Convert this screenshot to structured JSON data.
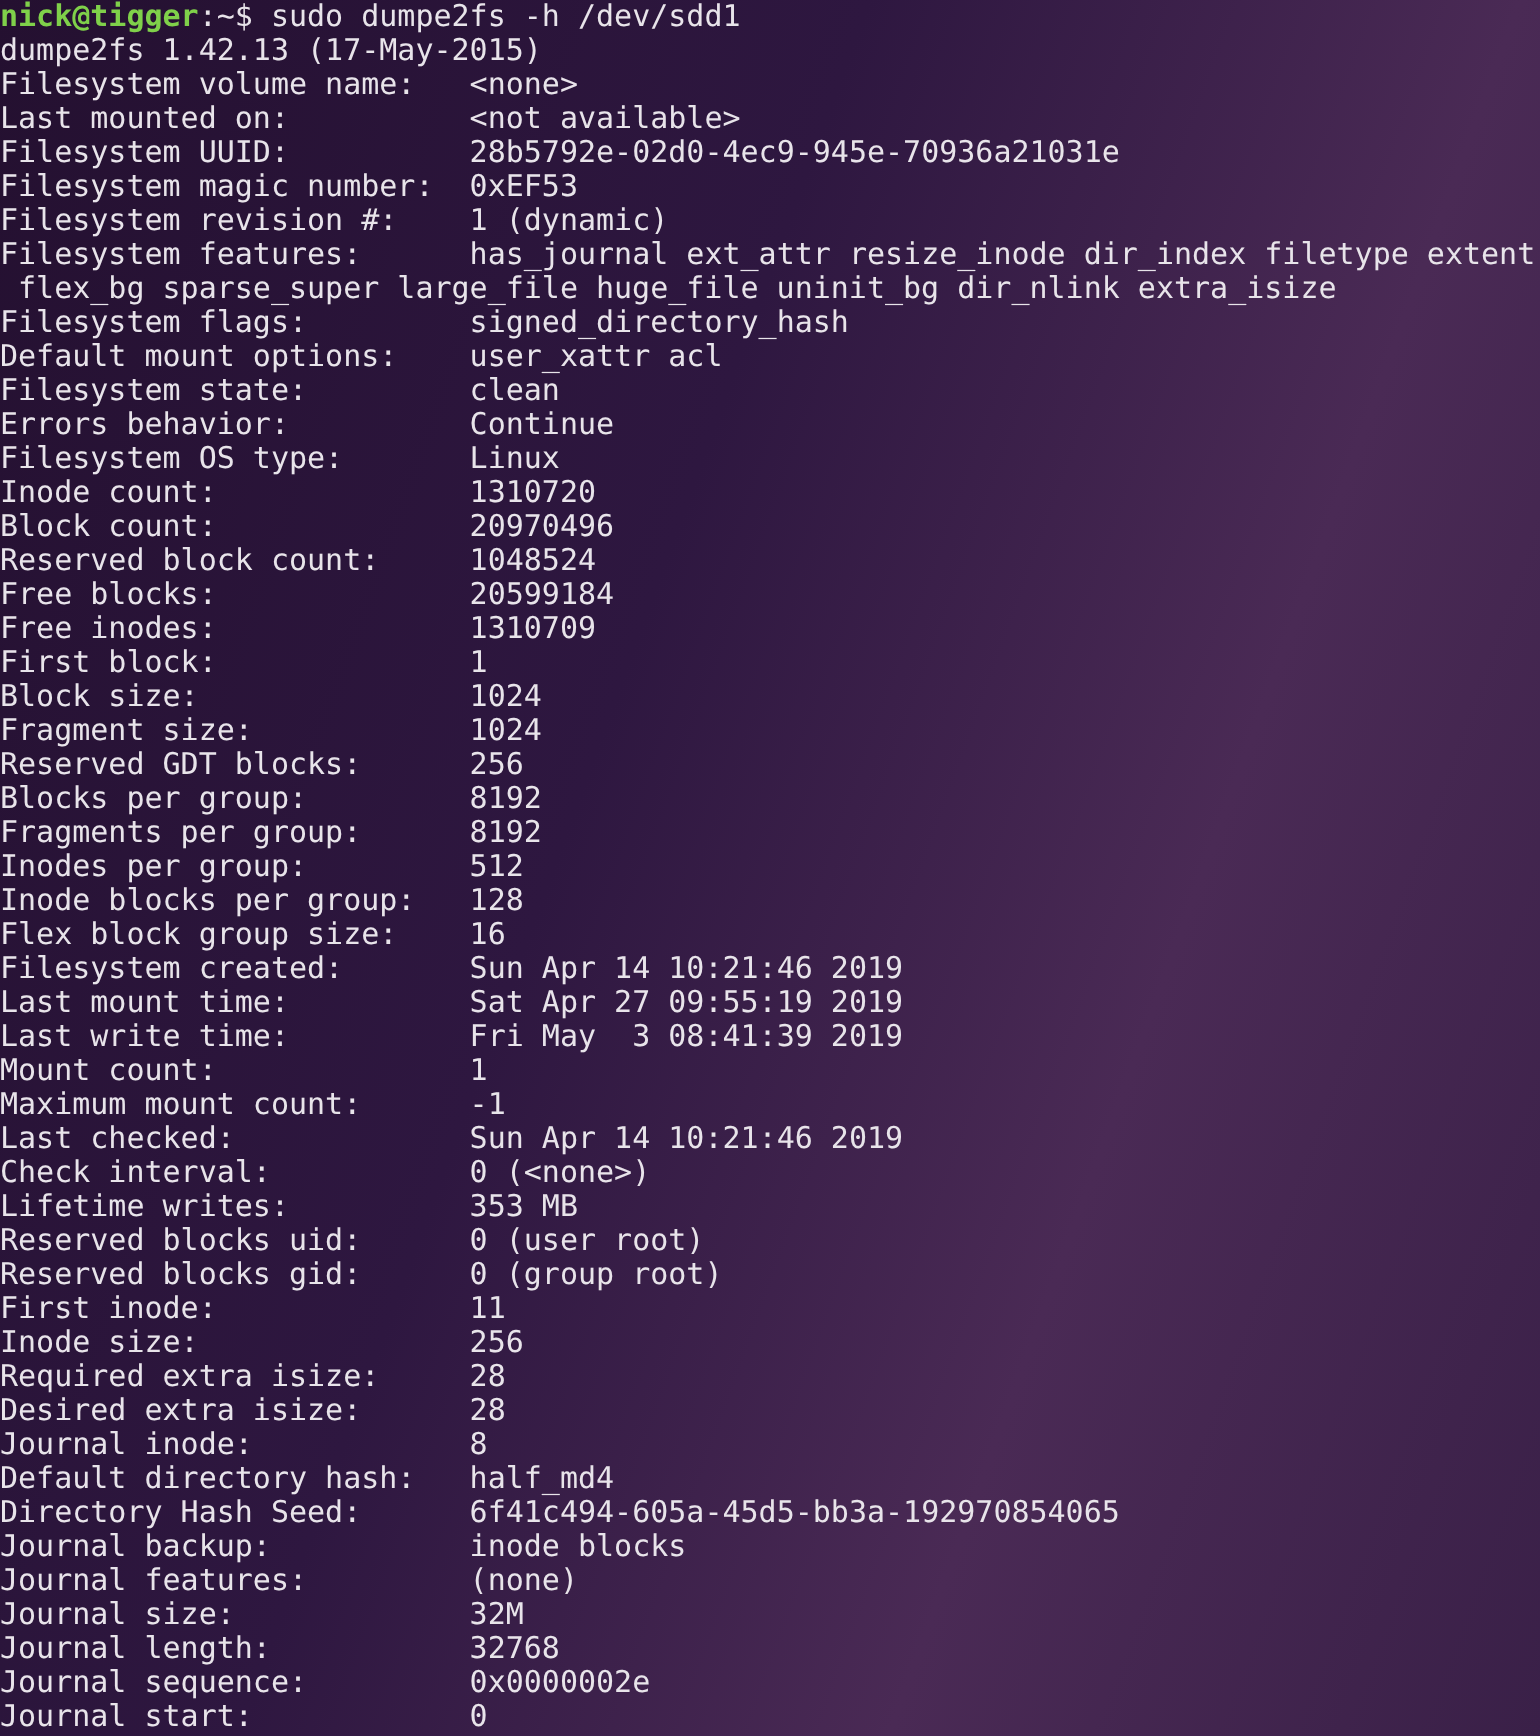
{
  "prompt": {
    "user_host": "nick@tigger",
    "separator": ":",
    "path": "~",
    "symbol": "$",
    "command": "sudo dumpe2fs -h /dev/sdd1"
  },
  "lines": [
    {
      "kind": "text",
      "text": "dumpe2fs 1.42.13 (17-May-2015)"
    },
    {
      "kind": "field",
      "label": "Filesystem volume name:",
      "value": "<none>"
    },
    {
      "kind": "field",
      "label": "Last mounted on:",
      "value": "<not available>"
    },
    {
      "kind": "field",
      "label": "Filesystem UUID:",
      "value": "28b5792e-02d0-4ec9-945e-70936a21031e"
    },
    {
      "kind": "field",
      "label": "Filesystem magic number:",
      "value": "0xEF53"
    },
    {
      "kind": "field",
      "label": "Filesystem revision #:",
      "value": "1 (dynamic)"
    },
    {
      "kind": "field",
      "label": "Filesystem features:",
      "value": "has_journal ext_attr resize_inode dir_index filetype extent"
    },
    {
      "kind": "wrap",
      "text": "flex_bg sparse_super large_file huge_file uninit_bg dir_nlink extra_isize"
    },
    {
      "kind": "field",
      "label": "Filesystem flags:",
      "value": "signed_directory_hash"
    },
    {
      "kind": "field",
      "label": "Default mount options:",
      "value": "user_xattr acl"
    },
    {
      "kind": "field",
      "label": "Filesystem state:",
      "value": "clean"
    },
    {
      "kind": "field",
      "label": "Errors behavior:",
      "value": "Continue"
    },
    {
      "kind": "field",
      "label": "Filesystem OS type:",
      "value": "Linux"
    },
    {
      "kind": "field",
      "label": "Inode count:",
      "value": "1310720"
    },
    {
      "kind": "field",
      "label": "Block count:",
      "value": "20970496"
    },
    {
      "kind": "field",
      "label": "Reserved block count:",
      "value": "1048524"
    },
    {
      "kind": "field",
      "label": "Free blocks:",
      "value": "20599184"
    },
    {
      "kind": "field",
      "label": "Free inodes:",
      "value": "1310709"
    },
    {
      "kind": "field",
      "label": "First block:",
      "value": "1"
    },
    {
      "kind": "field",
      "label": "Block size:",
      "value": "1024"
    },
    {
      "kind": "field",
      "label": "Fragment size:",
      "value": "1024"
    },
    {
      "kind": "field",
      "label": "Reserved GDT blocks:",
      "value": "256"
    },
    {
      "kind": "field",
      "label": "Blocks per group:",
      "value": "8192"
    },
    {
      "kind": "field",
      "label": "Fragments per group:",
      "value": "8192"
    },
    {
      "kind": "field",
      "label": "Inodes per group:",
      "value": "512"
    },
    {
      "kind": "field",
      "label": "Inode blocks per group:",
      "value": "128"
    },
    {
      "kind": "field",
      "label": "Flex block group size:",
      "value": "16"
    },
    {
      "kind": "field",
      "label": "Filesystem created:",
      "value": "Sun Apr 14 10:21:46 2019"
    },
    {
      "kind": "field",
      "label": "Last mount time:",
      "value": "Sat Apr 27 09:55:19 2019"
    },
    {
      "kind": "field",
      "label": "Last write time:",
      "value": "Fri May  3 08:41:39 2019"
    },
    {
      "kind": "field",
      "label": "Mount count:",
      "value": "1"
    },
    {
      "kind": "field",
      "label": "Maximum mount count:",
      "value": "-1"
    },
    {
      "kind": "field",
      "label": "Last checked:",
      "value": "Sun Apr 14 10:21:46 2019"
    },
    {
      "kind": "field",
      "label": "Check interval:",
      "value": "0 (<none>)"
    },
    {
      "kind": "field",
      "label": "Lifetime writes:",
      "value": "353 MB"
    },
    {
      "kind": "field",
      "label": "Reserved blocks uid:",
      "value": "0 (user root)"
    },
    {
      "kind": "field",
      "label": "Reserved blocks gid:",
      "value": "0 (group root)"
    },
    {
      "kind": "field",
      "label": "First inode:",
      "value": "11"
    },
    {
      "kind": "field",
      "label": "Inode size:",
      "value": "256"
    },
    {
      "kind": "field",
      "label": "Required extra isize:",
      "value": "28"
    },
    {
      "kind": "field",
      "label": "Desired extra isize:",
      "value": "28"
    },
    {
      "kind": "field",
      "label": "Journal inode:",
      "value": "8"
    },
    {
      "kind": "field",
      "label": "Default directory hash:",
      "value": "half_md4"
    },
    {
      "kind": "field",
      "label": "Directory Hash Seed:",
      "value": "6f41c494-605a-45d5-bb3a-192970854065"
    },
    {
      "kind": "field",
      "label": "Journal backup:",
      "value": "inode blocks"
    },
    {
      "kind": "field",
      "label": "Journal features:",
      "value": "(none)"
    },
    {
      "kind": "field",
      "label": "Journal size:",
      "value": "32M"
    },
    {
      "kind": "field",
      "label": "Journal length:",
      "value": "32768"
    },
    {
      "kind": "field",
      "label": "Journal sequence:",
      "value": "0x0000002e"
    },
    {
      "kind": "field",
      "label": "Journal start:",
      "value": "0"
    }
  ]
}
